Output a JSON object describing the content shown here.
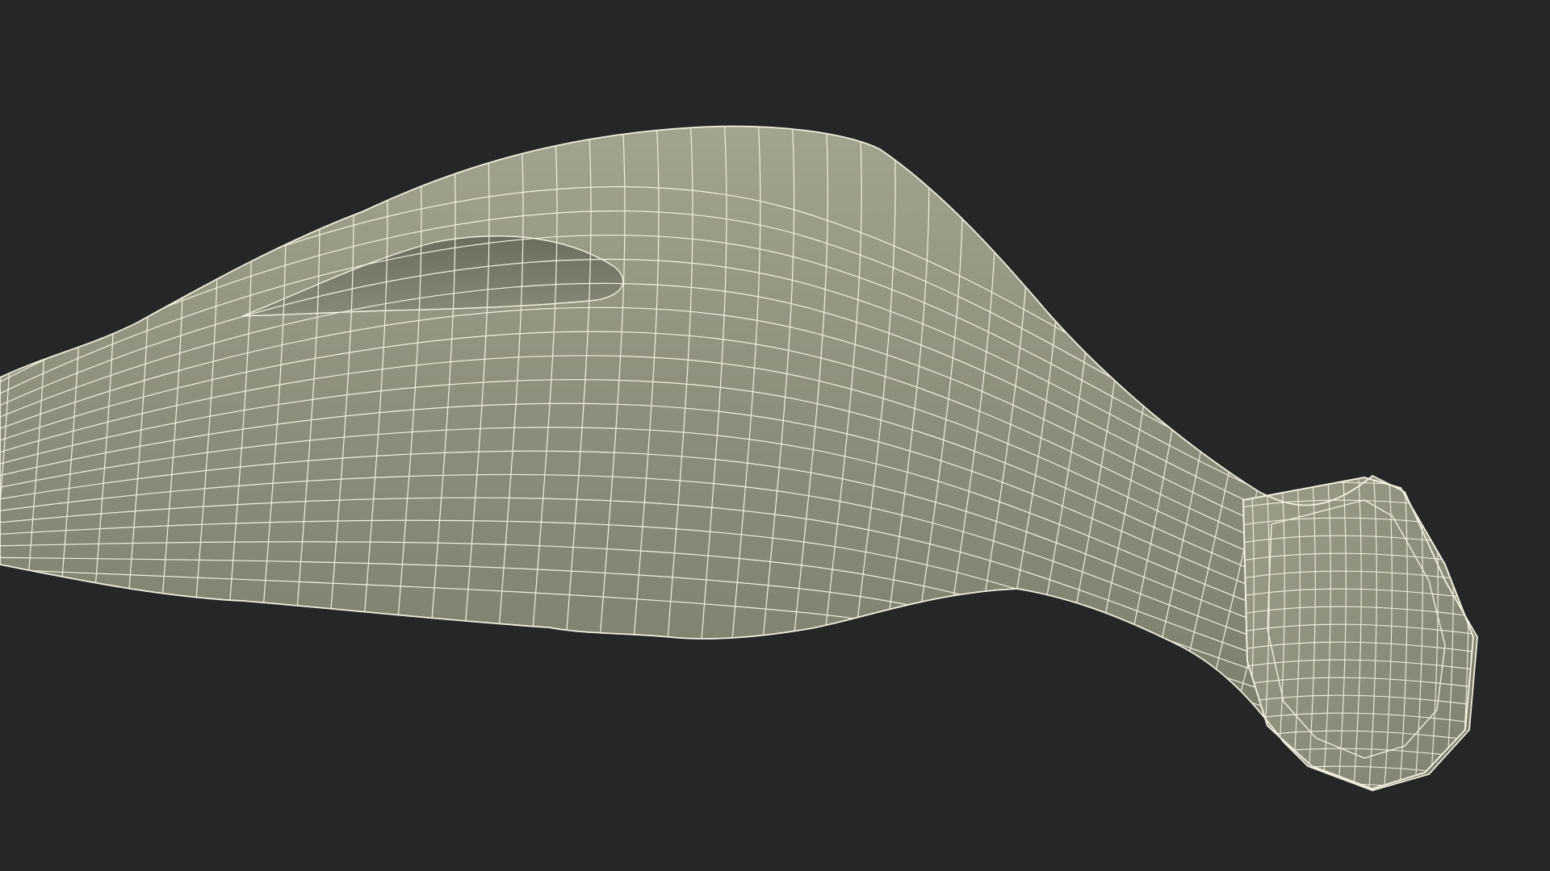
{
  "scene": {
    "background_color": "#262626",
    "object": "wireframe-3d-model",
    "surface_color": "#8e8f7d",
    "surface_highlight": "#a4a690",
    "surface_shadow": "#6f705f",
    "wire_color": "#f2efde"
  }
}
